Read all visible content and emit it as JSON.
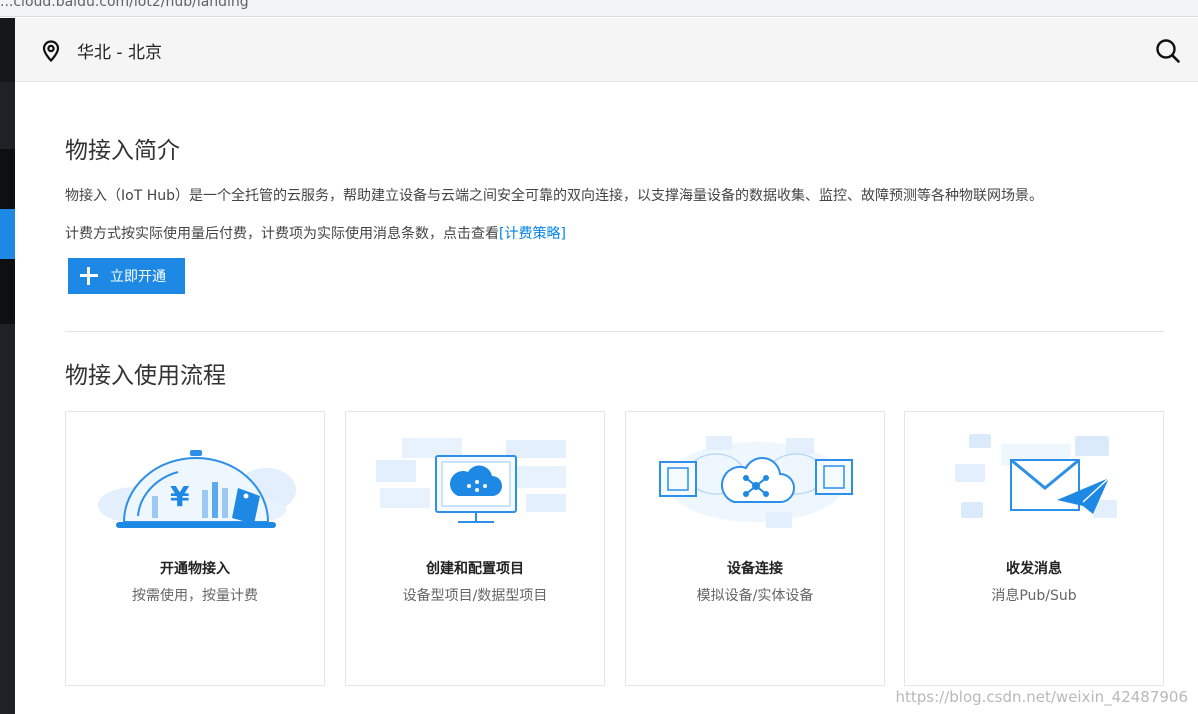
{
  "browser": {
    "url_fragment": "...cloud.baidu.com/iot2/hub/landing"
  },
  "topbar": {
    "region_label": "华北 - 北京"
  },
  "intro": {
    "title": "物接入简介",
    "description": "物接入（IoT Hub）是一个全托管的云服务，帮助建立设备与云端之间安全可靠的双向连接，以支撑海量设备的数据收集、监控、故障预测等各种物联网场景。",
    "billing_text": "计费方式按实际使用量后付费，计费项为实际使用消息条数，点击查看",
    "billing_link": "[计费策略]",
    "open_button": "立即开通"
  },
  "flow": {
    "title": "物接入使用流程",
    "cards": [
      {
        "title": "开通物接入",
        "subtitle": "按需使用，按量计费",
        "icon": "yuan-dome-icon"
      },
      {
        "title": "创建和配置项目",
        "subtitle": "设备型项目/数据型项目",
        "icon": "monitor-cloud-icon"
      },
      {
        "title": "设备连接",
        "subtitle": "模拟设备/实体设备",
        "icon": "cloud-network-icon"
      },
      {
        "title": "收发消息",
        "subtitle": "消息Pub/Sub",
        "icon": "envelope-plane-icon"
      }
    ]
  },
  "watermark": "https://blog.csdn.net/weixin_42487906",
  "colors": {
    "accent": "#1e88e5",
    "link": "#0084e9",
    "nav_bg": "#1e2126",
    "illustration_light": "#dbeafb"
  }
}
